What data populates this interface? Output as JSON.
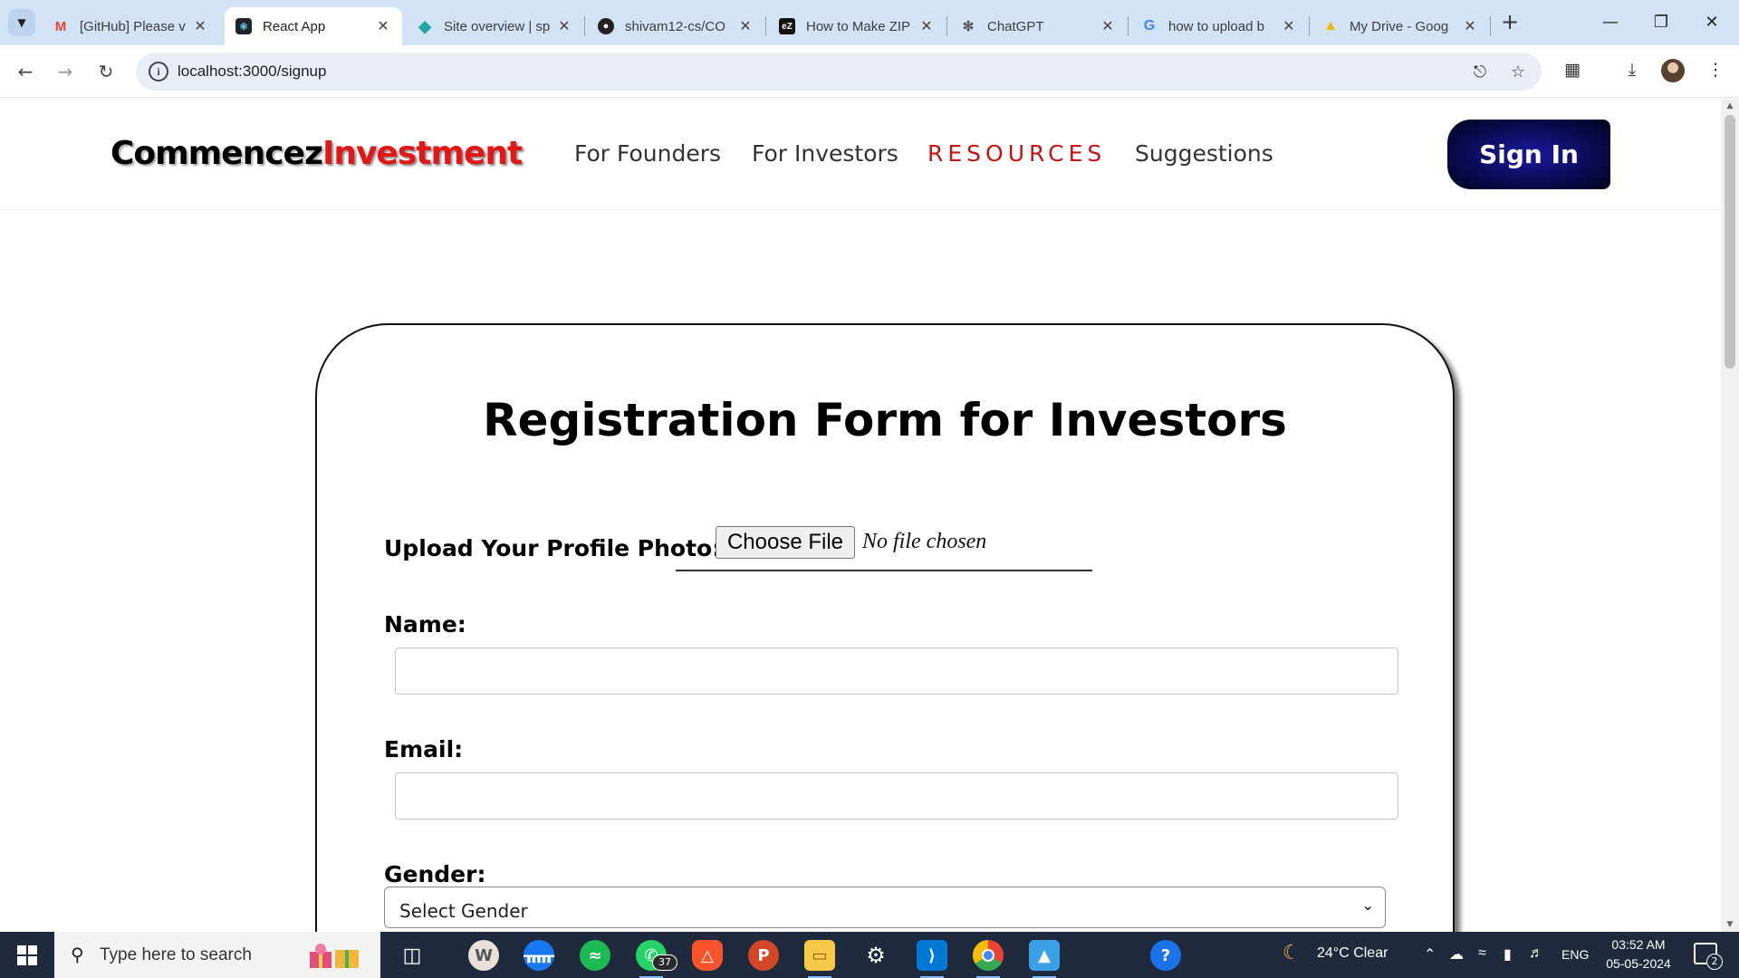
{
  "browser": {
    "tabs": [
      {
        "label": "[GitHub] Please v",
        "icon": "gmail-icon",
        "active": false
      },
      {
        "label": "React App",
        "icon": "react-icon",
        "active": true
      },
      {
        "label": "Site overview | sp",
        "icon": "netlify-icon",
        "active": false
      },
      {
        "label": "shivam12-cs/CO",
        "icon": "github-icon",
        "active": false
      },
      {
        "label": "How to Make ZIP",
        "icon": "ezyzip-icon",
        "active": false
      },
      {
        "label": "ChatGPT",
        "icon": "chatgpt-icon",
        "active": false
      },
      {
        "label": "how to upload b",
        "icon": "google-icon",
        "active": false
      },
      {
        "label": "My Drive - Goog",
        "icon": "google-drive-icon",
        "active": false
      }
    ],
    "url": "localhost:3000/signup"
  },
  "site": {
    "logo_part1": "Commencez",
    "logo_part2": "Investment",
    "nav": [
      "For Founders",
      "For Investors",
      "RESOURCES",
      "Suggestions"
    ],
    "signin_label": "Sign In",
    "colors": {
      "accent_red": "#e51616",
      "signin_navy": "#0b0b55"
    }
  },
  "form": {
    "title": "Registration Form for Investors",
    "photo_label": "Upload Your Profile Photo:",
    "file_button": "Choose File",
    "file_status": "No file chosen",
    "name_label": "Name:",
    "name_value": "",
    "email_label": "Email:",
    "email_value": "",
    "gender_label": "Gender:",
    "gender_selected": "Select Gender"
  },
  "taskbar": {
    "search_placeholder": "Type here to search",
    "whatsapp_badge": "37",
    "weather": "24°C  Clear",
    "language": "ENG",
    "time": "03:52 AM",
    "date": "05-05-2024",
    "notification_count": "2"
  }
}
